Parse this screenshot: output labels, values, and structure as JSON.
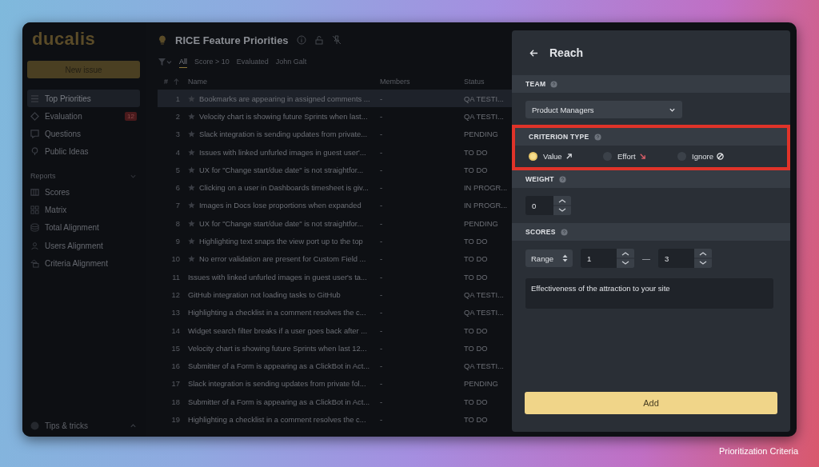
{
  "sidebar": {
    "logo": "ducalis",
    "new_issue_button": "New issue",
    "items": [
      {
        "label": "Top Priorities",
        "selected": true
      },
      {
        "label": "Evaluation",
        "selected": false,
        "badge": "12"
      },
      {
        "label": "Questions",
        "selected": false
      },
      {
        "label": "Public Ideas",
        "selected": false
      }
    ],
    "reports_heading": "Reports",
    "reports": [
      {
        "label": "Scores",
        "selected": false
      },
      {
        "label": "Matrix",
        "selected": false
      },
      {
        "label": "Total Alignment",
        "selected": false
      },
      {
        "label": "Users Alignment",
        "selected": false
      },
      {
        "label": "Criteria Alignment",
        "selected": false
      }
    ],
    "footer": "Tips & tricks"
  },
  "header": {
    "title": "RICE Feature Priorities"
  },
  "filters": [
    {
      "label": "All",
      "selected": true
    },
    {
      "label": "Score > 10",
      "selected": false
    },
    {
      "label": "Evaluated",
      "selected": false
    },
    {
      "label": "John Galt",
      "selected": false
    }
  ],
  "table": {
    "columns": [
      "#",
      "Name",
      "Members",
      "Status"
    ],
    "rows": [
      {
        "number": "1",
        "starred": true,
        "name": "Bookmarks are appearing in assigned comments ...",
        "members": "-",
        "status": "QA TESTI...",
        "selected": true
      },
      {
        "number": "2",
        "starred": true,
        "name": "Velocity chart is showing future Sprints when last...",
        "members": "-",
        "status": "QA TESTI...",
        "selected": false
      },
      {
        "number": "3",
        "starred": true,
        "name": "Slack integration is sending updates from private...",
        "members": "-",
        "status": "PENDING",
        "selected": false
      },
      {
        "number": "4",
        "starred": true,
        "name": "Issues with linked unfurled images in guest user'...",
        "members": "-",
        "status": "TO DO",
        "selected": false
      },
      {
        "number": "5",
        "starred": true,
        "name": "UX for \"Change start/due date\" is not straightfor...",
        "members": "-",
        "status": "TO DO",
        "selected": false
      },
      {
        "number": "6",
        "starred": true,
        "name": "Clicking on a user in Dashboards timesheet is giv...",
        "members": "-",
        "status": "IN PROGR...",
        "selected": false
      },
      {
        "number": "7",
        "starred": true,
        "name": "Images in Docs lose proportions when expanded",
        "members": "-",
        "status": "IN PROGR...",
        "selected": false
      },
      {
        "number": "8",
        "starred": true,
        "name": "UX for \"Change start/due date\" is not straightfor...",
        "members": "-",
        "status": "PENDING",
        "selected": false
      },
      {
        "number": "9",
        "starred": true,
        "name": "Highlighting text snaps the view port up to the top",
        "members": "-",
        "status": "TO DO",
        "selected": false
      },
      {
        "number": "10",
        "starred": true,
        "name": "No error validation are present for Custom Field ...",
        "members": "-",
        "status": "TO DO",
        "selected": false
      },
      {
        "number": "11",
        "starred": false,
        "name": "Issues with linked unfurled images in guest user's ta...",
        "members": "-",
        "status": "TO DO",
        "selected": false
      },
      {
        "number": "12",
        "starred": false,
        "name": "GitHub integration not loading tasks to GitHub",
        "members": "-",
        "status": "QA TESTI...",
        "selected": false
      },
      {
        "number": "13",
        "starred": false,
        "name": "Highlighting a checklist in a comment resolves the c...",
        "members": "-",
        "status": "QA TESTI...",
        "selected": false
      },
      {
        "number": "14",
        "starred": false,
        "name": "Widget search filter breaks if a user goes back after ...",
        "members": "-",
        "status": "TO DO",
        "selected": false
      },
      {
        "number": "15",
        "starred": false,
        "name": "Velocity chart is showing future Sprints when last 12...",
        "members": "-",
        "status": "TO DO",
        "selected": false
      },
      {
        "number": "16",
        "starred": false,
        "name": "Submitter of a Form is appearing as a ClickBot in Act...",
        "members": "-",
        "status": "QA TESTI...",
        "selected": false
      },
      {
        "number": "17",
        "starred": false,
        "name": "Slack integration is sending updates from private fol...",
        "members": "-",
        "status": "PENDING",
        "selected": false
      },
      {
        "number": "18",
        "starred": false,
        "name": "Submitter of a Form is appearing as a ClickBot in Act...",
        "members": "-",
        "status": "TO DO",
        "selected": false
      },
      {
        "number": "19",
        "starred": false,
        "name": "Highlighting a checklist in a comment resolves the c...",
        "members": "-",
        "status": "TO DO",
        "selected": false
      }
    ]
  },
  "panel": {
    "title": "Reach",
    "team": {
      "heading": "TEAM",
      "value": "Product Managers"
    },
    "criterion_type": {
      "heading": "CRITERION TYPE",
      "highlighted": true,
      "options": [
        {
          "label": "Value",
          "kind": "value",
          "selected": true
        },
        {
          "label": "Effort",
          "kind": "effort",
          "selected": false
        },
        {
          "label": "Ignore",
          "kind": "ignore",
          "selected": false
        }
      ]
    },
    "weight": {
      "heading": "WEIGHT",
      "value": "0"
    },
    "scores": {
      "heading": "SCORES",
      "mode": "Range",
      "min": "1",
      "separator": "—",
      "max": "3",
      "description": "Effectiveness of the attraction to your site"
    },
    "add_button": "Add"
  },
  "caption": "Prioritization Criteria"
}
